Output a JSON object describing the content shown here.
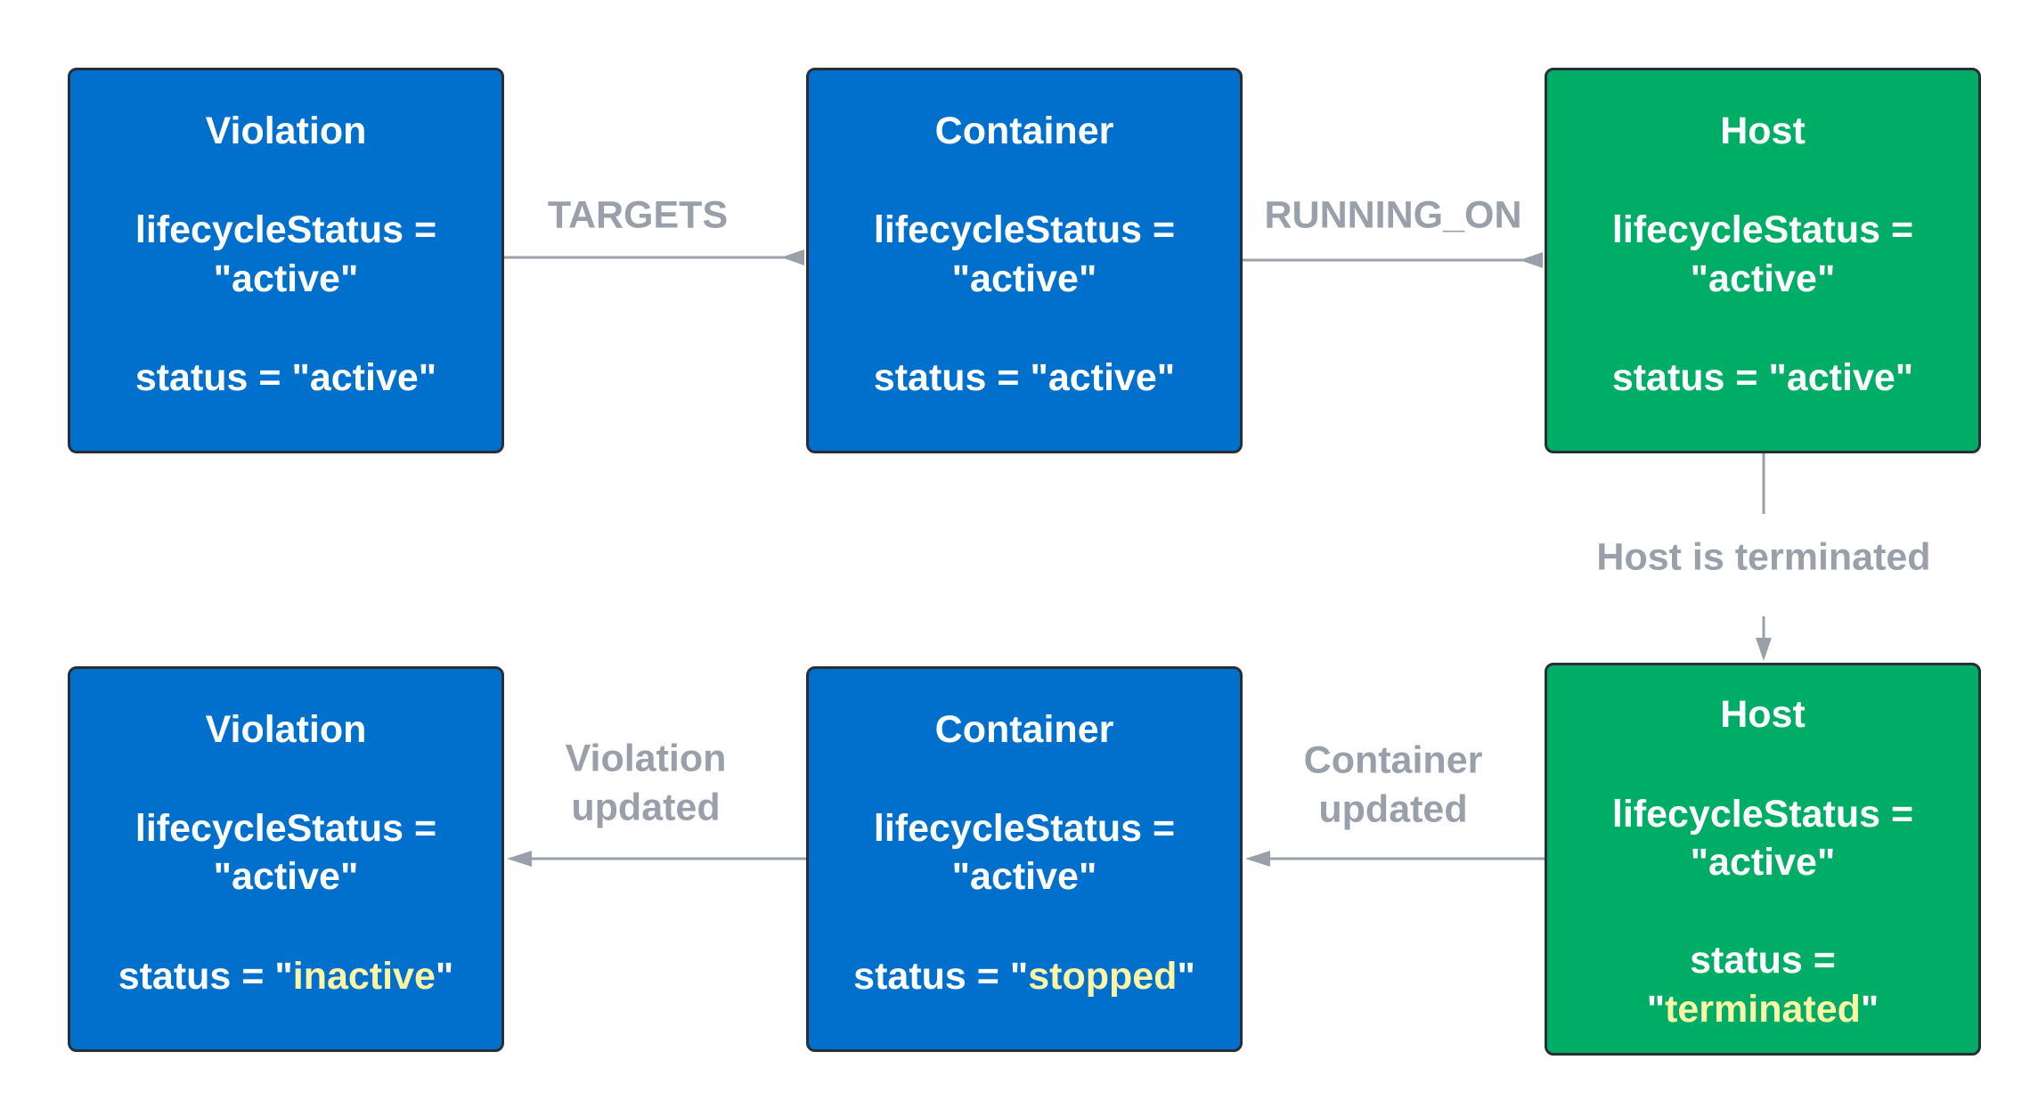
{
  "colors": {
    "entity_blue": "#0070cc",
    "host_green": "#00ad66",
    "connector_gray": "#9aa0a9",
    "highlight_yellow": "#fdf5a6"
  },
  "top_row": [
    {
      "title": "Violation",
      "lifecycle_line1": "lifecycleStatus =",
      "lifecycle_line2": "\"active\"",
      "status": "status = \"active\""
    },
    {
      "title": "Container",
      "lifecycle_line1": "lifecycleStatus =",
      "lifecycle_line2": "\"active\"",
      "status": "status = \"active\""
    },
    {
      "title": "Host",
      "lifecycle_line1": "lifecycleStatus =",
      "lifecycle_line2": "\"active\"",
      "status": "status = \"active\""
    }
  ],
  "bottom_row": [
    {
      "title": "Violation",
      "lifecycle_line1": "lifecycleStatus =",
      "lifecycle_line2": "\"active\"",
      "status_prefix": "status = \"",
      "status_value": "inactive",
      "status_suffix": "\""
    },
    {
      "title": "Container",
      "lifecycle_line1": "lifecycleStatus =",
      "lifecycle_line2": "\"active\"",
      "status_prefix": "status = \"",
      "status_value": "stopped",
      "status_suffix": "\""
    },
    {
      "title": "Host",
      "lifecycle_line1": "lifecycleStatus =",
      "lifecycle_line2": "\"active\"",
      "status_line1": "status =",
      "status_prefix": "\"",
      "status_value": "terminated",
      "status_suffix": "\""
    }
  ],
  "edges": {
    "targets": "TARGETS",
    "running_on": "RUNNING_ON",
    "host_terminated": "Host is terminated",
    "container_updated_1": "Container",
    "container_updated_2": "updated",
    "violation_updated_1": "Violation",
    "violation_updated_2": "updated"
  }
}
